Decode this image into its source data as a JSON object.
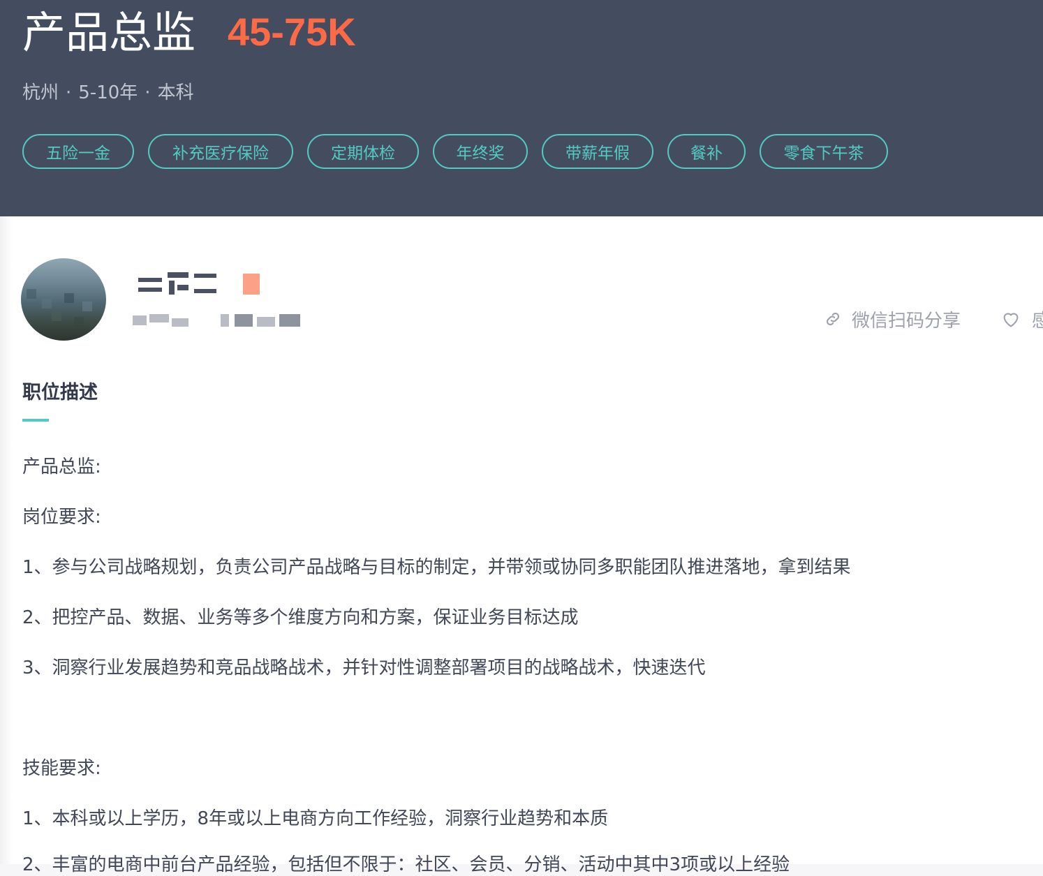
{
  "job": {
    "title": "产品总监",
    "salary": "45-75K",
    "city": "杭州",
    "experience": "5-10年",
    "education": "本科",
    "separator": "·"
  },
  "benefits": [
    "五险一金",
    "补充医疗保险",
    "定期体检",
    "年终奖",
    "带薪年假",
    "餐补",
    "零食下午茶"
  ],
  "actions": {
    "share_label": "微信扫码分享",
    "favorite_label": "感"
  },
  "description": {
    "section_title": "职位描述",
    "lines": [
      "产品总监:",
      "岗位要求:",
      "1、参与公司战略规划，负责公司产品战略与目标的制定，并带领或协同多职能团队推进落地，拿到结果",
      "2、把控产品、数据、业务等多个维度方向和方案，保证业务目标达成",
      "3、洞察行业发展趋势和竞品战略战术，并针对性调整部署项目的战略战术，快速迭代",
      "",
      "技能要求:",
      "1、本科或以上学历，8年或以上电商方向工作经验，洞察行业趋势和本质",
      "2、丰富的电商中前台产品经验，包括但不限于：社区、会员、分销、活动中其中3项或以上经验"
    ]
  },
  "colors": {
    "header_bg": "#444c5f",
    "salary": "#fd6a45",
    "tag_accent": "#53cac3",
    "text_primary": "#414757"
  }
}
